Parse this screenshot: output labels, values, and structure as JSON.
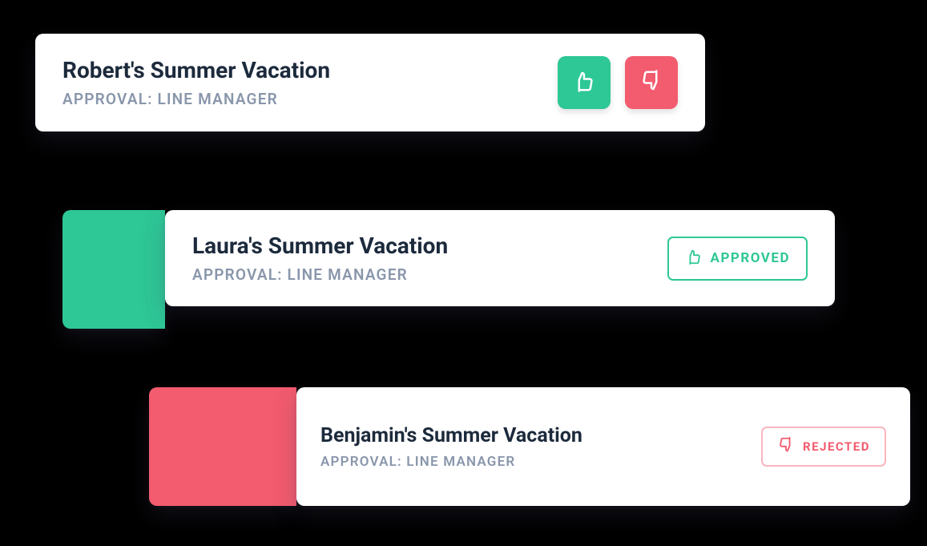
{
  "colors": {
    "approve": "#2ec796",
    "reject": "#f35b6e",
    "title": "#1c2a3c",
    "subtitle": "#8996ab"
  },
  "cards": [
    {
      "title": "Robert's Summer Vacation",
      "subtitle": "APPROVAL: LINE MANAGER",
      "state": "pending"
    },
    {
      "title": "Laura's Summer Vacation",
      "subtitle": "APPROVAL: LINE MANAGER",
      "state": "approved",
      "status_label": "APPROVED"
    },
    {
      "title": "Benjamin's Summer Vacation",
      "subtitle": "APPROVAL: LINE MANAGER",
      "state": "rejected",
      "status_label": "REJECTED"
    }
  ]
}
